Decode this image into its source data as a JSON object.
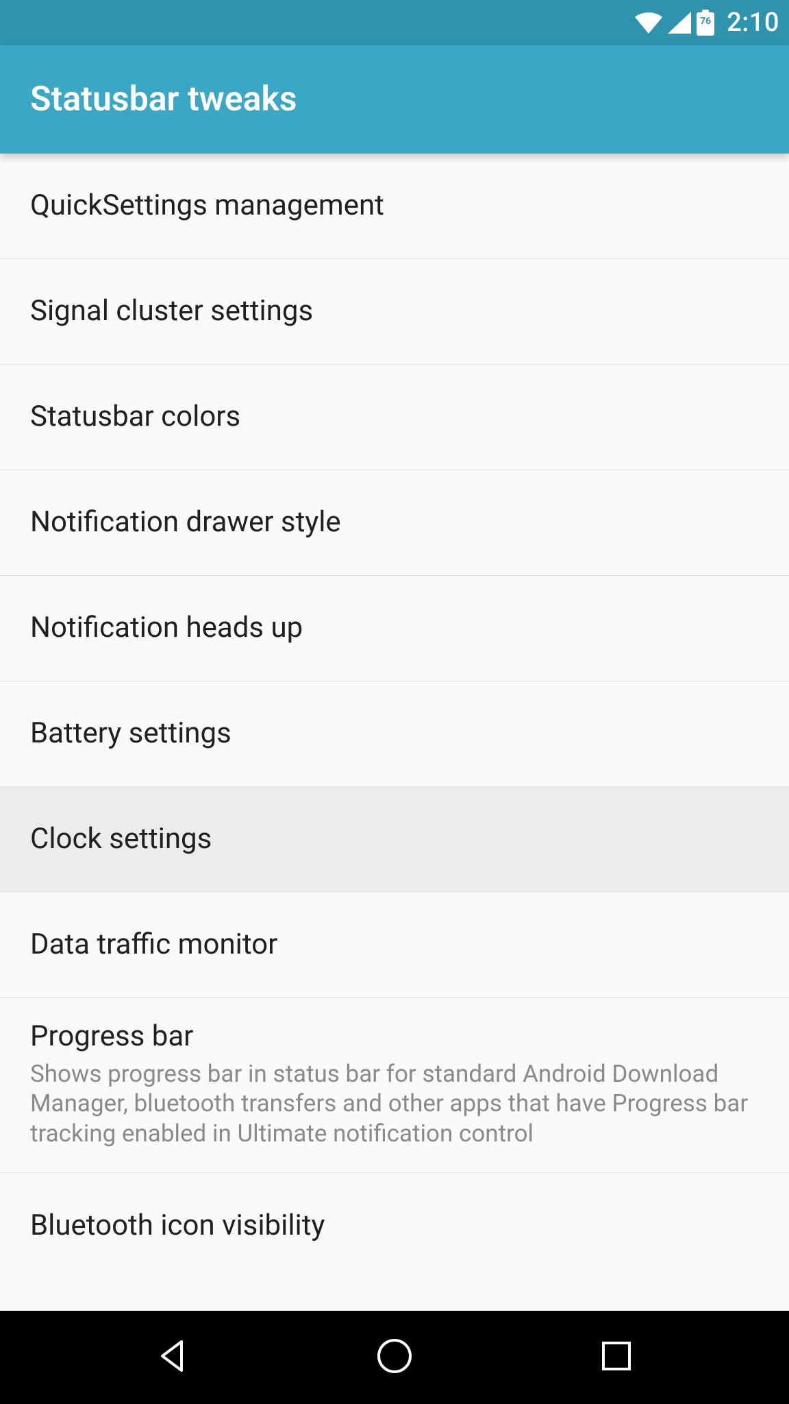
{
  "status_bar": {
    "battery_pct": "76",
    "clock": "2:10"
  },
  "app_bar": {
    "title": "Statusbar tweaks"
  },
  "list": {
    "items": [
      {
        "title": "QuickSettings management",
        "subtitle": "",
        "selected": false
      },
      {
        "title": "Signal cluster settings",
        "subtitle": "",
        "selected": false
      },
      {
        "title": "Statusbar colors",
        "subtitle": "",
        "selected": false
      },
      {
        "title": "Notification drawer style",
        "subtitle": "",
        "selected": false
      },
      {
        "title": "Notification heads up",
        "subtitle": "",
        "selected": false
      },
      {
        "title": "Battery settings",
        "subtitle": "",
        "selected": false
      },
      {
        "title": "Clock settings",
        "subtitle": "",
        "selected": true
      },
      {
        "title": "Data traffic monitor",
        "subtitle": "",
        "selected": false
      },
      {
        "title": "Progress bar",
        "subtitle": "Shows progress bar in status bar for standard Android Download Manager, bluetooth transfers and other apps that have Progress bar tracking enabled in Ultimate notification control",
        "selected": false
      },
      {
        "title": "Bluetooth icon visibility",
        "subtitle": "",
        "selected": false
      }
    ]
  }
}
